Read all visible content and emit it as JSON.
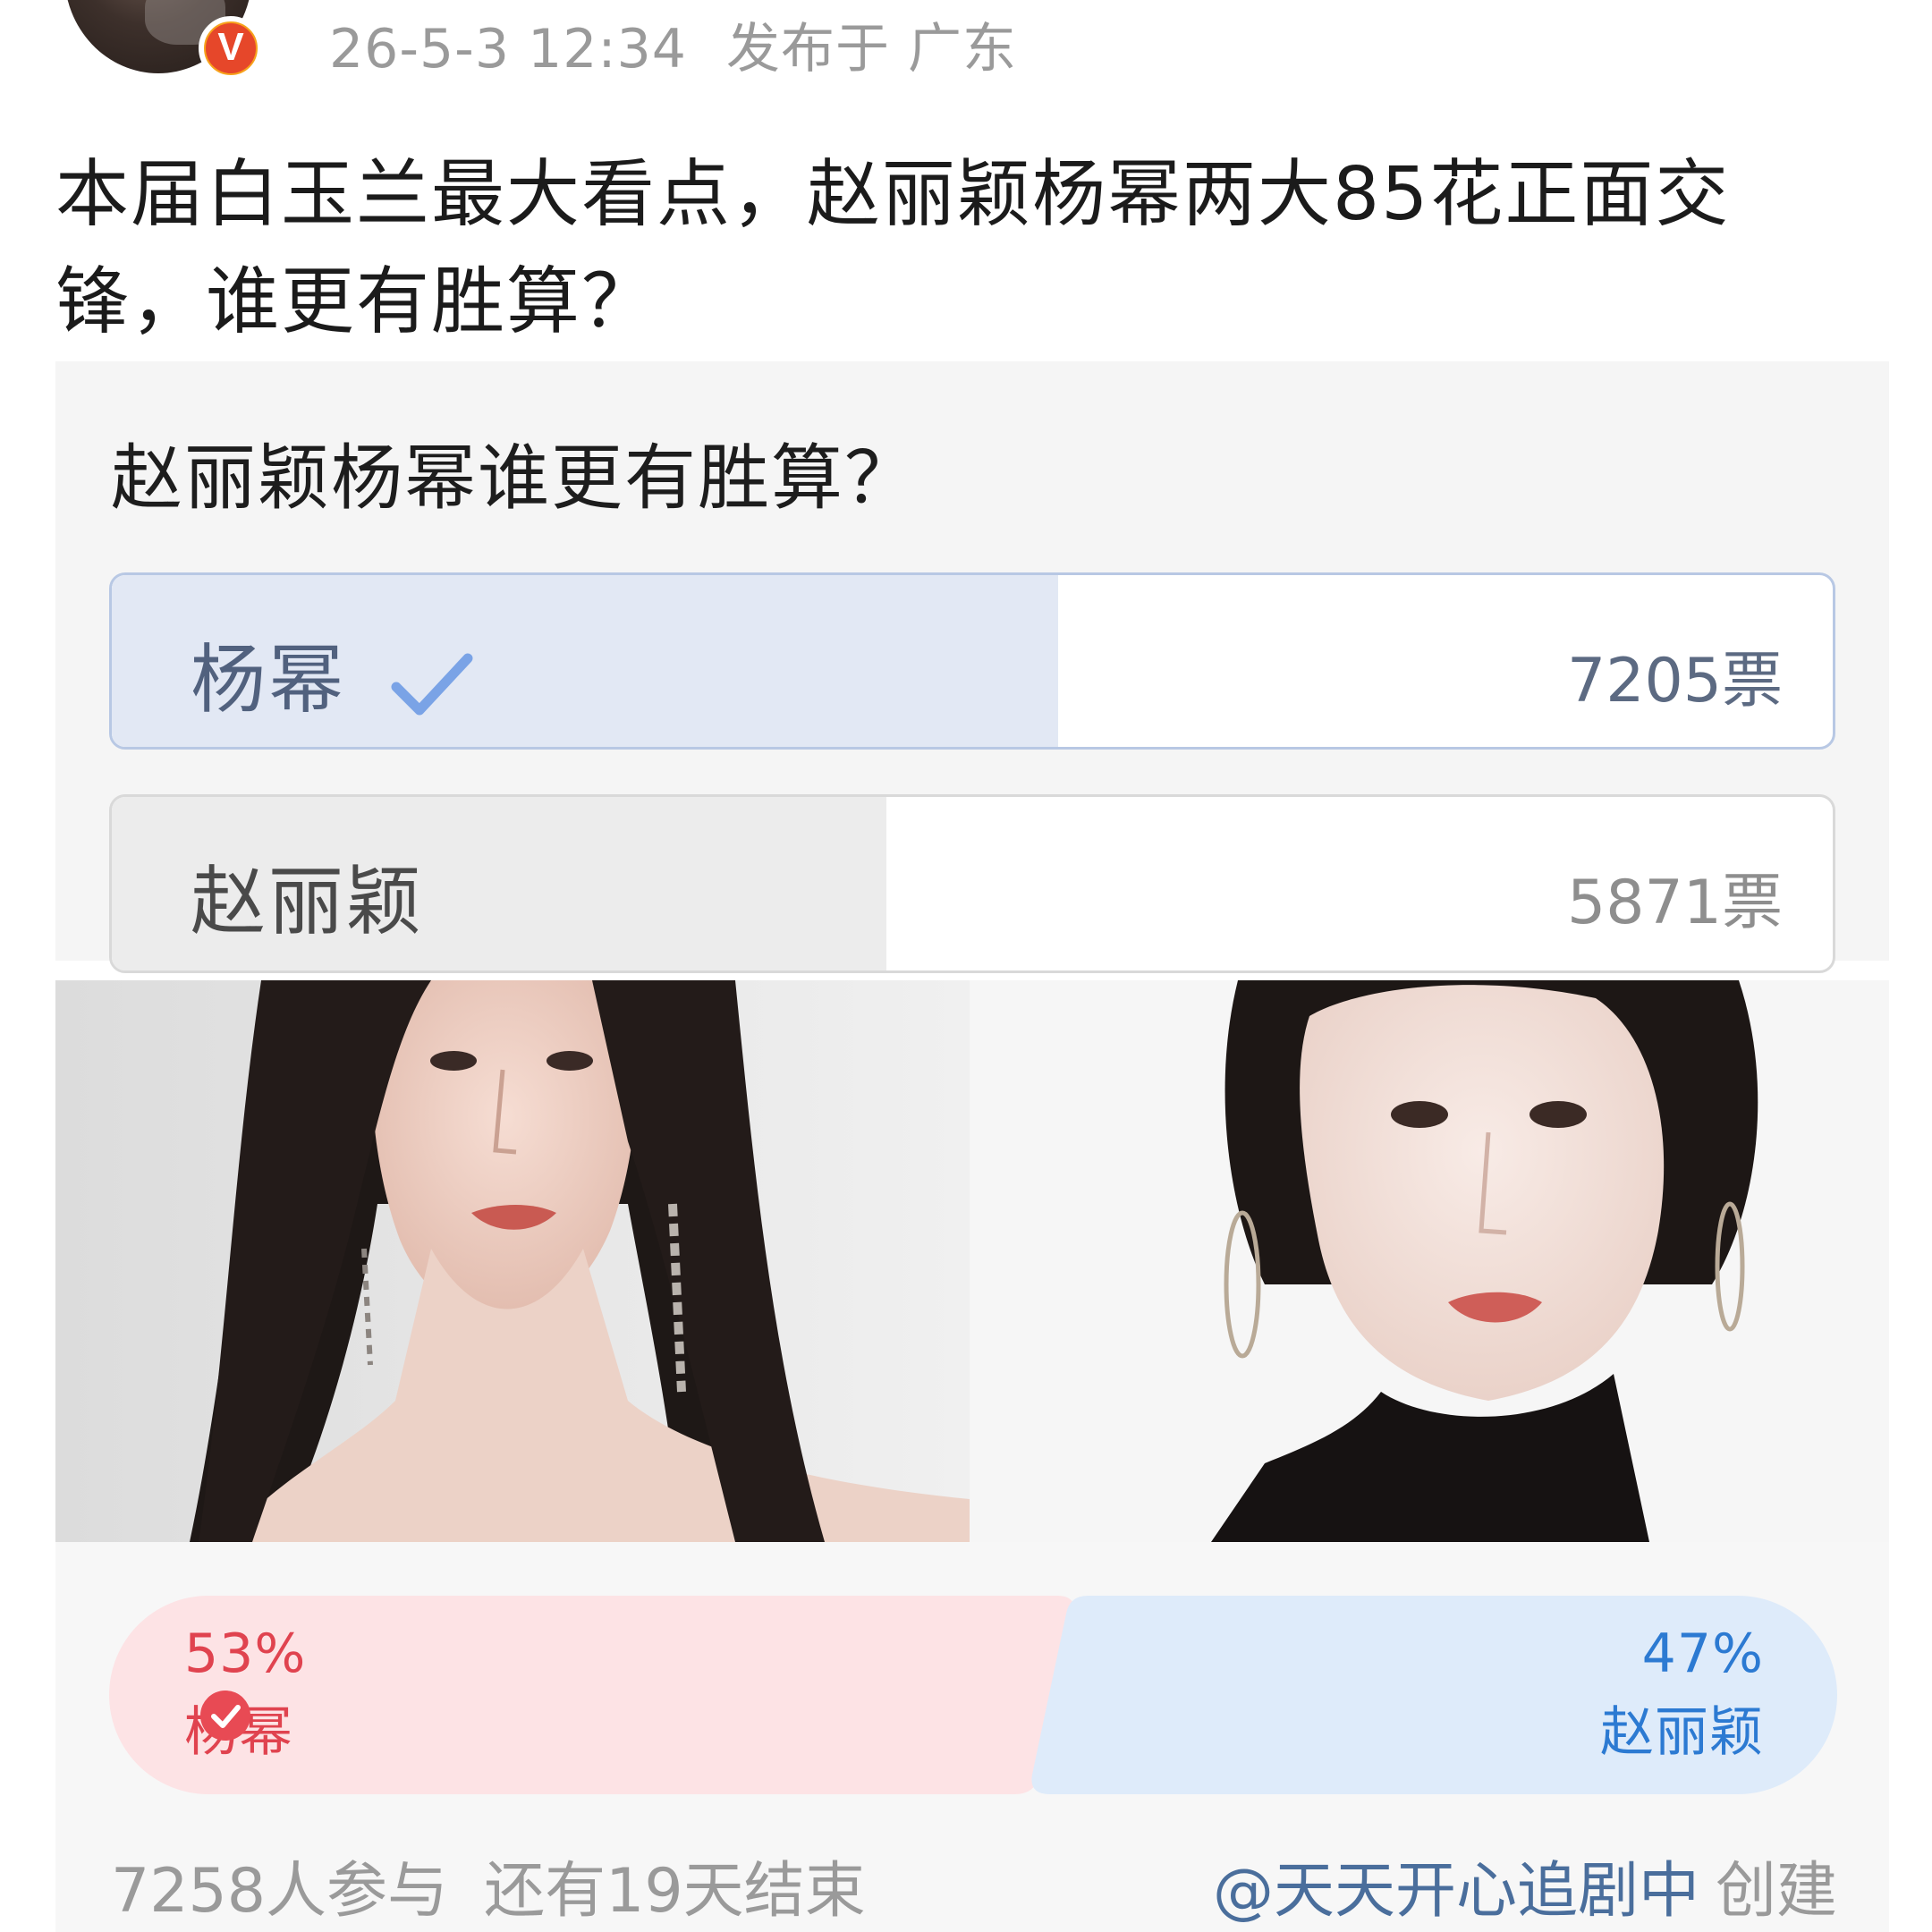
{
  "header": {
    "timestamp": "26-5-3 12:34",
    "location": "发布于 广东",
    "verified_badge": "V",
    "avatar_icon": "avatar-image"
  },
  "post": {
    "text": "本届白玉兰最大看点，赵丽颖杨幂两大85花正面交锋，谁更有胜算？"
  },
  "poll": {
    "question": "赵丽颖杨幂谁更有胜算？",
    "options": [
      {
        "label": "杨幂",
        "votes_text": "7205票",
        "votes": 7205,
        "fill_fraction": 0.55,
        "selected": true,
        "icon": "check-icon"
      },
      {
        "label": "赵丽颖",
        "votes_text": "5871票",
        "votes": 5871,
        "fill_fraction": 0.45,
        "selected": false
      }
    ]
  },
  "pk": {
    "left": {
      "percent": "53%",
      "name": "杨幂",
      "icon": "check-circle-icon",
      "color": "#e0434f"
    },
    "right": {
      "percent": "47%",
      "name": "赵丽颖",
      "color": "#2c7ad2"
    }
  },
  "footer": {
    "participants": "7258人参与",
    "remaining": "还有19天结束",
    "creator": "@天天开心追剧中",
    "created_label": "创建"
  },
  "colors": {
    "selected_fill": "#e2e8f4",
    "selected_border": "#b8c8e4",
    "check_blue": "#7aa3e6",
    "pk_left_bg": "#fde3e5",
    "pk_right_bg": "#deebfa",
    "creator_link": "#4a6e9c"
  }
}
